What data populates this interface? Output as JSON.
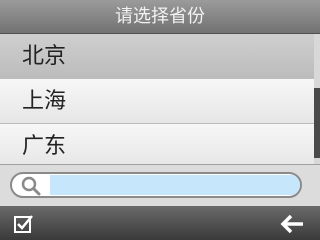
{
  "header": {
    "title": "请选择省份"
  },
  "list": {
    "items": [
      "北京",
      "上海",
      "广东"
    ]
  },
  "search": {
    "value": "",
    "placeholder": ""
  },
  "icons": {
    "search": "search-icon",
    "confirm": "checkbox-checked-icon",
    "back": "back-arrow-icon"
  },
  "colors": {
    "title_bar": "#858585",
    "selected_row": "#c6c6c6",
    "search_field": "#c6e6fb",
    "bottom_bar": "#4a4a4a"
  }
}
